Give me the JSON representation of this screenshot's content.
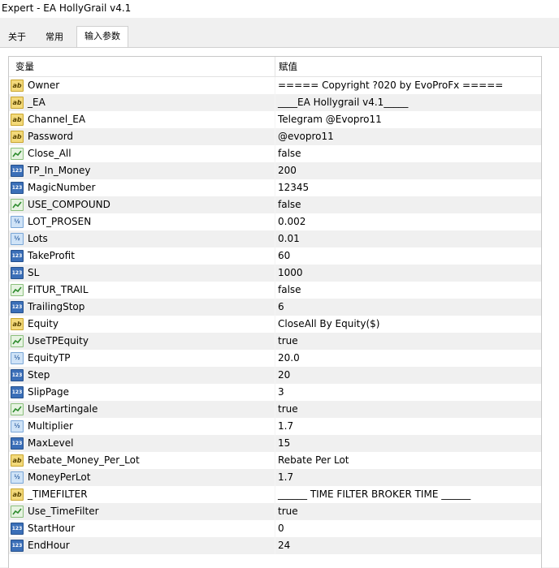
{
  "window": {
    "title": "Expert - EA HollyGrail v4.1"
  },
  "tabs": [
    {
      "label": "关于",
      "active": false
    },
    {
      "label": "常用",
      "active": false
    },
    {
      "label": "输入参数",
      "active": true
    }
  ],
  "table": {
    "columns": {
      "name": "变量",
      "value": "赋值"
    },
    "rows": [
      {
        "type": "string",
        "icon_text": "ab",
        "name": "Owner",
        "value": "===== Copyright ?020 by EvoProFx ====="
      },
      {
        "type": "string",
        "icon_text": "ab",
        "name": "_EA",
        "value": "____EA Hollygrail v4.1_____"
      },
      {
        "type": "string",
        "icon_text": "ab",
        "name": "Channel_EA",
        "value": "Telegram @Evopro11"
      },
      {
        "type": "string",
        "icon_text": "ab",
        "name": "Password",
        "value": "@evopro11"
      },
      {
        "type": "bool",
        "icon_text": "",
        "name": "Close_All",
        "value": "false"
      },
      {
        "type": "int",
        "icon_text": "123",
        "name": "TP_In_Money",
        "value": "200"
      },
      {
        "type": "int",
        "icon_text": "123",
        "name": "MagicNumber",
        "value": "12345"
      },
      {
        "type": "bool",
        "icon_text": "",
        "name": "USE_COMPOUND",
        "value": "false"
      },
      {
        "type": "double",
        "icon_text": "½",
        "name": "LOT_PROSEN",
        "value": "0.002"
      },
      {
        "type": "double",
        "icon_text": "½",
        "name": "Lots",
        "value": "0.01"
      },
      {
        "type": "int",
        "icon_text": "123",
        "name": "TakeProfit",
        "value": "60"
      },
      {
        "type": "int",
        "icon_text": "123",
        "name": "SL",
        "value": "1000"
      },
      {
        "type": "bool",
        "icon_text": "",
        "name": "FITUR_TRAIL",
        "value": "false"
      },
      {
        "type": "int",
        "icon_text": "123",
        "name": "TrailingStop",
        "value": "6"
      },
      {
        "type": "string",
        "icon_text": "ab",
        "name": "Equity",
        "value": "CloseAll By Equity($)"
      },
      {
        "type": "bool",
        "icon_text": "",
        "name": "UseTPEquity",
        "value": "true"
      },
      {
        "type": "double",
        "icon_text": "½",
        "name": "EquityTP",
        "value": "20.0"
      },
      {
        "type": "int",
        "icon_text": "123",
        "name": "Step",
        "value": "20"
      },
      {
        "type": "int",
        "icon_text": "123",
        "name": "SlipPage",
        "value": "3"
      },
      {
        "type": "bool",
        "icon_text": "",
        "name": "UseMartingale",
        "value": "true"
      },
      {
        "type": "double",
        "icon_text": "½",
        "name": "Multiplier",
        "value": "1.7"
      },
      {
        "type": "int",
        "icon_text": "123",
        "name": "MaxLevel",
        "value": "15"
      },
      {
        "type": "string",
        "icon_text": "ab",
        "name": "Rebate_Money_Per_Lot",
        "value": "Rebate Per Lot"
      },
      {
        "type": "double",
        "icon_text": "½",
        "name": "MoneyPerLot",
        "value": "1.7"
      },
      {
        "type": "string",
        "icon_text": "ab",
        "name": "_TIMEFILTER",
        "value": "______ TIME FILTER BROKER TIME ______"
      },
      {
        "type": "bool",
        "icon_text": "",
        "name": "Use_TimeFilter",
        "value": "true"
      },
      {
        "type": "int",
        "icon_text": "123",
        "name": "StartHour",
        "value": "0"
      },
      {
        "type": "int",
        "icon_text": "123",
        "name": "EndHour",
        "value": "24"
      }
    ]
  }
}
